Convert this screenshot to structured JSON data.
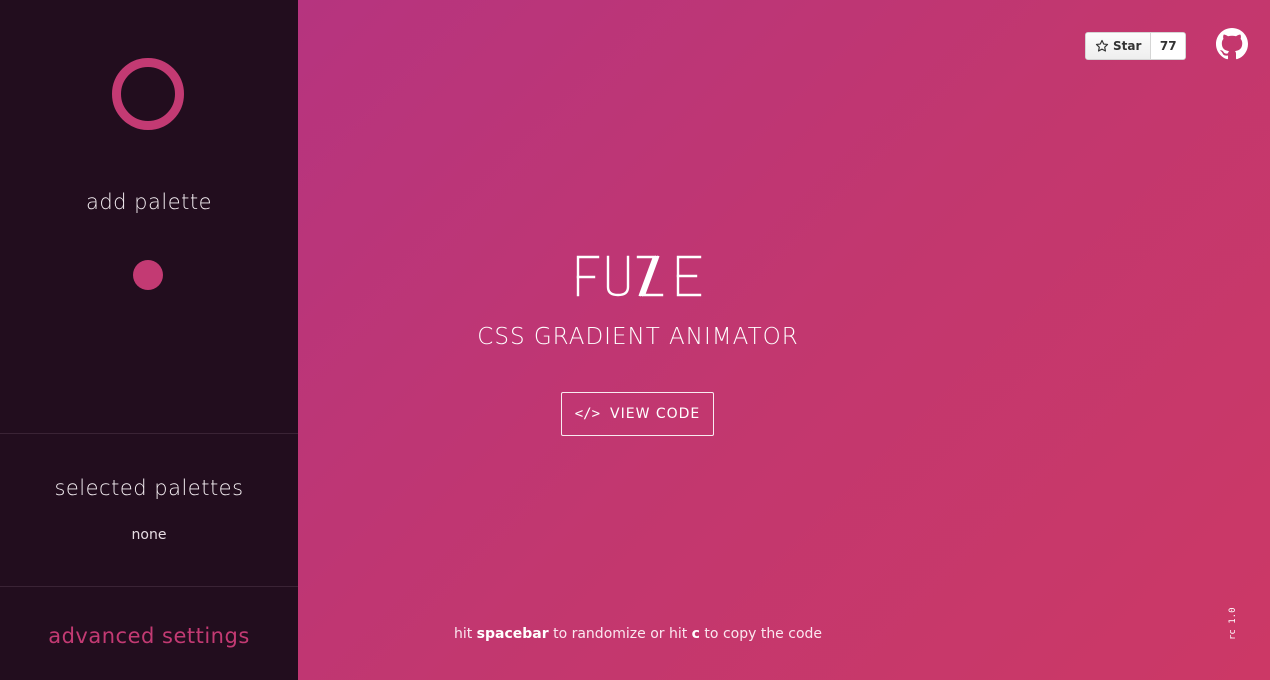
{
  "sidebar": {
    "add_palette_label": "add palette",
    "selected_palettes_title": "selected palettes",
    "selected_palettes_value": "none",
    "advanced_settings_label": "advanced settings"
  },
  "header": {
    "star_label": "Star",
    "star_count": "77",
    "github_icon": "github-icon"
  },
  "main": {
    "logo_text": "FUZE",
    "subtitle": "CSS GRADIENT ANIMATOR",
    "view_code_label": "VIEW CODE",
    "view_code_icon": "</>",
    "hint_prefix": "hit ",
    "hint_key1": "spacebar",
    "hint_middle": " to randomize or hit ",
    "hint_key2": "c",
    "hint_suffix": " to copy the code",
    "version": "rc 1.0"
  },
  "colors": {
    "sidebar_bg": "#220d1e",
    "accent": "#c33a73",
    "gradient_start": "#b6347f",
    "gradient_end": "#cc3866"
  }
}
